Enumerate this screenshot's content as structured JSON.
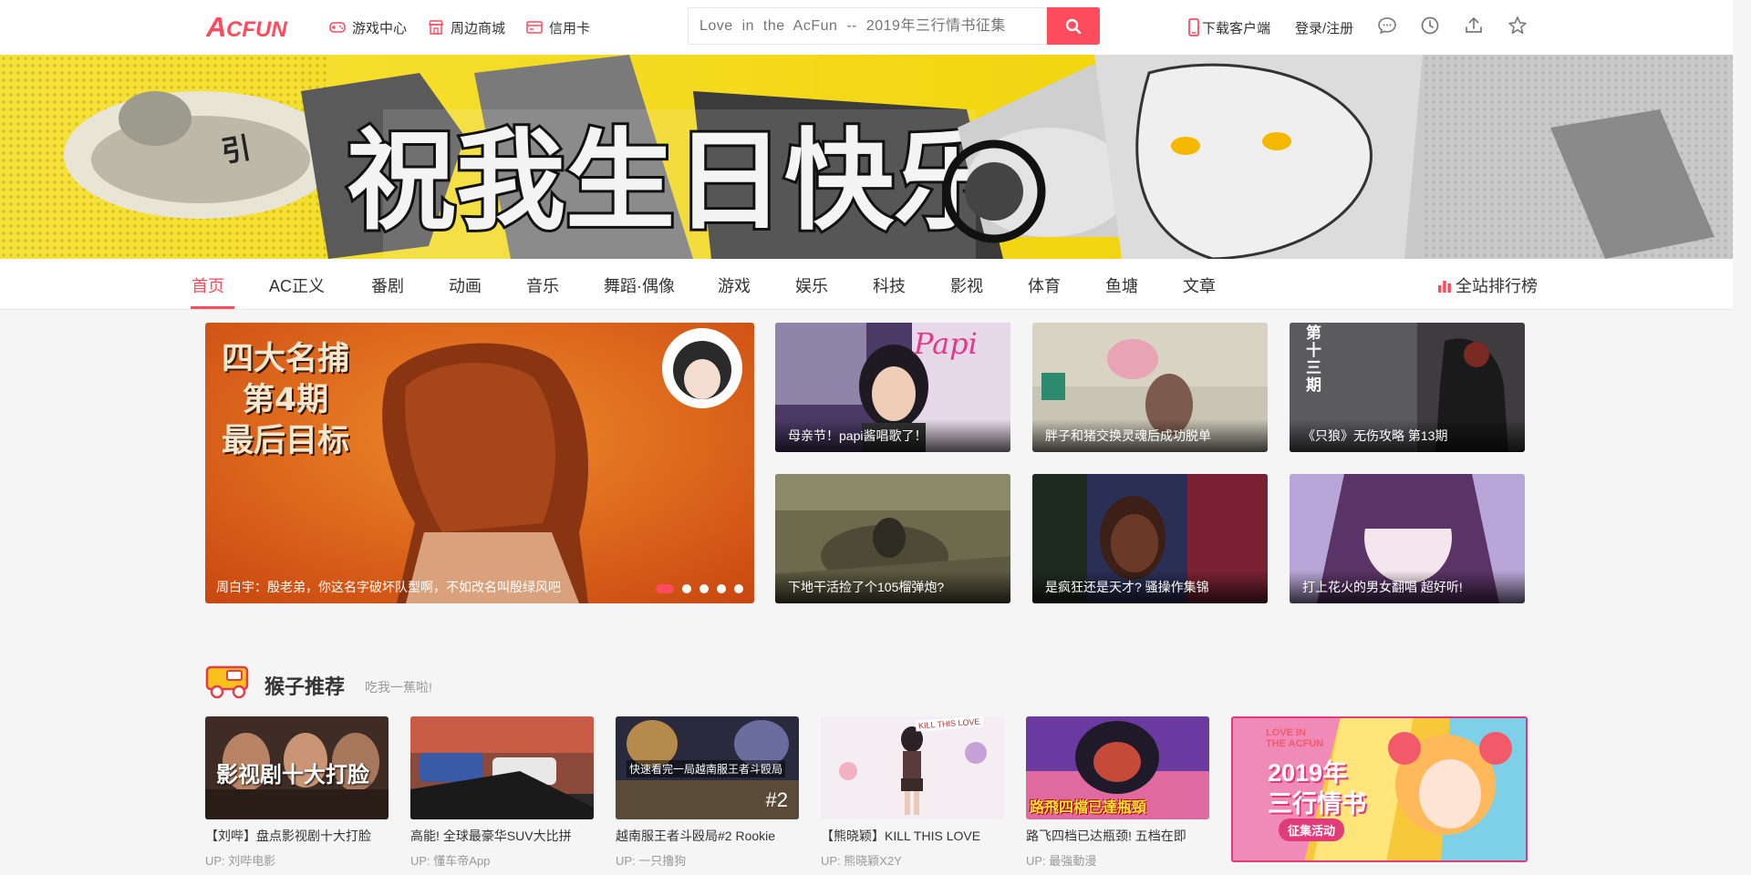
{
  "header": {
    "logo_text": "ACFUN",
    "links": [
      {
        "label": "游戏中心",
        "icon": "gamepad-icon"
      },
      {
        "label": "周边商城",
        "icon": "shop-icon"
      },
      {
        "label": "信用卡",
        "icon": "credit-card-icon"
      }
    ],
    "search_placeholder": "Love  in  the  AcFun  --  2019年三行情书征集",
    "download_label": "下载客户端",
    "login_label": "登录/注册",
    "accent": "#fd4c5d"
  },
  "nav": {
    "items": [
      "首页",
      "AC正义",
      "番剧",
      "动画",
      "音乐",
      "舞蹈·偶像",
      "游戏",
      "娱乐",
      "科技",
      "影视",
      "体育",
      "鱼塘",
      "文章"
    ],
    "active_index": 0,
    "rank_label": "全站排行榜"
  },
  "hero": {
    "overlay_lines": [
      "四大名捕",
      "第4期",
      "最后目标"
    ],
    "caption": "周白宇：殷老弟，你这名字破坏队型啊，不如改名叫殷绿风吧",
    "slide_count": 5,
    "active_slide": 0
  },
  "tiles": [
    {
      "caption": "母亲节！papi酱唱歌了！",
      "overlay": "Papi"
    },
    {
      "caption": "胖子和猪交换灵魂后成功脱单",
      "overlay": ""
    },
    {
      "caption": "《只狼》无伤攻略  第13期",
      "overlay": "第十三期"
    },
    {
      "caption": "下地干活捡了个105榴弹炮?",
      "overlay": ""
    },
    {
      "caption": "是疯狂还是天才? 骚操作集锦",
      "overlay": ""
    },
    {
      "caption": "打上花火的男女翻唱  超好听!",
      "overlay": ""
    }
  ],
  "section": {
    "title": "猴子推荐",
    "subtitle": "吃我一蕉啦!"
  },
  "cards": [
    {
      "title": "【刘哔】盘点影视剧十大打脸",
      "up": "UP:  刘哔电影",
      "overlay": "影视剧十大打脸"
    },
    {
      "title": "高能! 全球最豪华SUV大比拼",
      "up": "UP:  懂车帝App",
      "overlay": ""
    },
    {
      "title": "越南服王者斗殴局#2  Rookie",
      "up": "UP:  一只撸狗",
      "overlay": "快速看完一局越南服王者斗殴局"
    },
    {
      "title": "【熊晓颖】KILL  THIS  LOVE",
      "up": "UP:  熊晓颖X2Y",
      "overlay": "KILL THIS LOVE"
    },
    {
      "title": "路飞四档已达瓶颈! 五档在即",
      "up": "UP:  最強動漫",
      "overlay": "路飛四檔已達瓶頸"
    }
  ],
  "promo": {
    "line1": "LOVE IN",
    "line2": "THE ACFUN",
    "line3": "2019年",
    "line4": "三行情书",
    "button": "征集活动"
  }
}
